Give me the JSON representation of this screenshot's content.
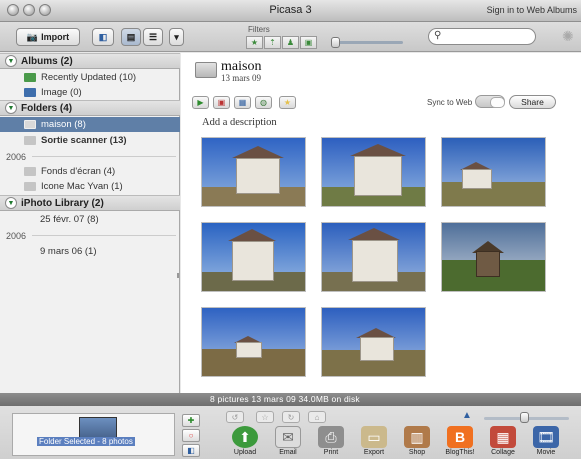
{
  "window": {
    "title": "Picasa 3",
    "signin_text": "Sign in to Web Albums"
  },
  "toolbar": {
    "import_label": "Import",
    "filters_label": "Filters",
    "search_placeholder": ""
  },
  "sidebar": {
    "albums": {
      "header": "Albums (2)",
      "items": [
        {
          "label": "Recently Updated (10)",
          "icon": "recent-icon"
        },
        {
          "label": "Image (0)",
          "icon": "album-icon"
        }
      ]
    },
    "folders": {
      "header": "Folders (4)",
      "items": [
        {
          "label": "maison (8)",
          "icon": "folder-icon",
          "selected": true
        },
        {
          "label": "Sortie scanner (13)",
          "icon": "folder-icon",
          "selected": false
        }
      ],
      "year_2006_label": "2006",
      "items_2006": [
        {
          "label": "Fonds d'écran (4)",
          "icon": "folder-icon"
        },
        {
          "label": "Icone Mac Yvan (1)",
          "icon": "folder-icon"
        }
      ]
    },
    "iphoto": {
      "header": "iPhoto Library (2)",
      "items": [
        {
          "label": "25 févr. 07 (8)"
        }
      ],
      "year_2006_label": "2006",
      "items_2006": [
        {
          "label": "9 mars 06 (1)"
        }
      ]
    }
  },
  "album": {
    "title": "maison",
    "date": "13 mars 09",
    "sync_label": "Sync to Web",
    "share_label": "Share",
    "description_placeholder": "Add a description",
    "photos": [
      {
        "name": "photo-1"
      },
      {
        "name": "photo-2"
      },
      {
        "name": "photo-3"
      },
      {
        "name": "photo-4"
      },
      {
        "name": "photo-5"
      },
      {
        "name": "photo-6"
      },
      {
        "name": "photo-7"
      },
      {
        "name": "photo-8"
      }
    ]
  },
  "status": {
    "text": "8 pictures     13 mars 09     34.0MB on disk"
  },
  "tray": {
    "selection_label": "Folder Selected - 8 photos",
    "tools": [
      {
        "name": "upload",
        "label": "Upload",
        "color": "#3c9a3c"
      },
      {
        "name": "email",
        "label": "Email",
        "color": "#cfcfcf"
      },
      {
        "name": "print",
        "label": "Print",
        "color": "#9a9a9a"
      },
      {
        "name": "export",
        "label": "Export",
        "color": "#c9b789"
      },
      {
        "name": "shop",
        "label": "Shop",
        "color": "#b07a4a"
      },
      {
        "name": "blogthis",
        "label": "BlogThis!",
        "color": "#f07020"
      },
      {
        "name": "collage",
        "label": "Collage",
        "color": "#c24a3b"
      },
      {
        "name": "movie",
        "label": "Movie",
        "color": "#3c66a8"
      }
    ]
  },
  "colors": {
    "selection": "#5f7fa7",
    "accent_green": "#1f7a2f"
  }
}
